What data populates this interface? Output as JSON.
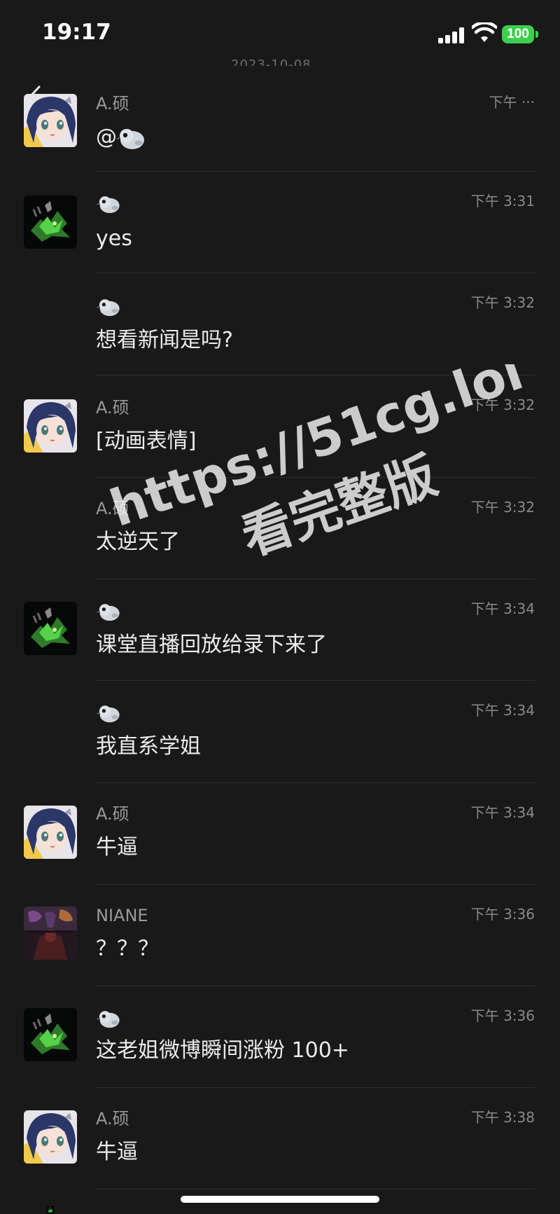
{
  "status_bar": {
    "time": "19:17",
    "battery": "100"
  },
  "messages": [
    {
      "sender": "A.硕",
      "time": "下午 ···",
      "text": "@",
      "avatar": "anime-girl",
      "has_text_bird": true
    },
    {
      "sender": "",
      "time": "下午 3:31",
      "text": "yes",
      "avatar": "green-dragon"
    },
    {
      "sender": "",
      "time": "下午 3:32",
      "text": "想看新闻是吗?",
      "avatar": ""
    },
    {
      "sender": "A.硕",
      "time": "下午 3:32",
      "text": "[动画表情]",
      "avatar": "anime-girl"
    },
    {
      "sender": "A.硕",
      "time": "下午 3:32",
      "text": "太逆天了",
      "avatar": ""
    },
    {
      "sender": "",
      "time": "下午 3:34",
      "text": "课堂直播回放给录下来了",
      "avatar": "green-dragon"
    },
    {
      "sender": "",
      "time": "下午 3:34",
      "text": "我直系学姐",
      "avatar": ""
    },
    {
      "sender": "A.硕",
      "time": "下午 3:34",
      "text": "牛逼",
      "avatar": "anime-girl"
    },
    {
      "sender": "NIANE",
      "time": "下午 3:36",
      "text": "？？？",
      "avatar": "dark-warrior"
    },
    {
      "sender": "",
      "time": "下午 3:36",
      "text": "这老姐微博瞬间涨粉 100+",
      "avatar": "green-dragon"
    },
    {
      "sender": "A.硕",
      "time": "下午 3:38",
      "text": "牛逼",
      "avatar": "anime-girl"
    }
  ],
  "watermark": {
    "line1": "https://51cg.lol",
    "line2": "看完整版"
  },
  "icons": {
    "back": "chevron-left-icon",
    "signal": "cellular-signal-icon",
    "wifi": "wifi-icon",
    "battery": "battery-icon",
    "bird_emoji": "bird-emoji-icon"
  },
  "colors": {
    "background": "#191919",
    "battery_green": "#3ccf4e",
    "divider": "#2e2e2e"
  }
}
